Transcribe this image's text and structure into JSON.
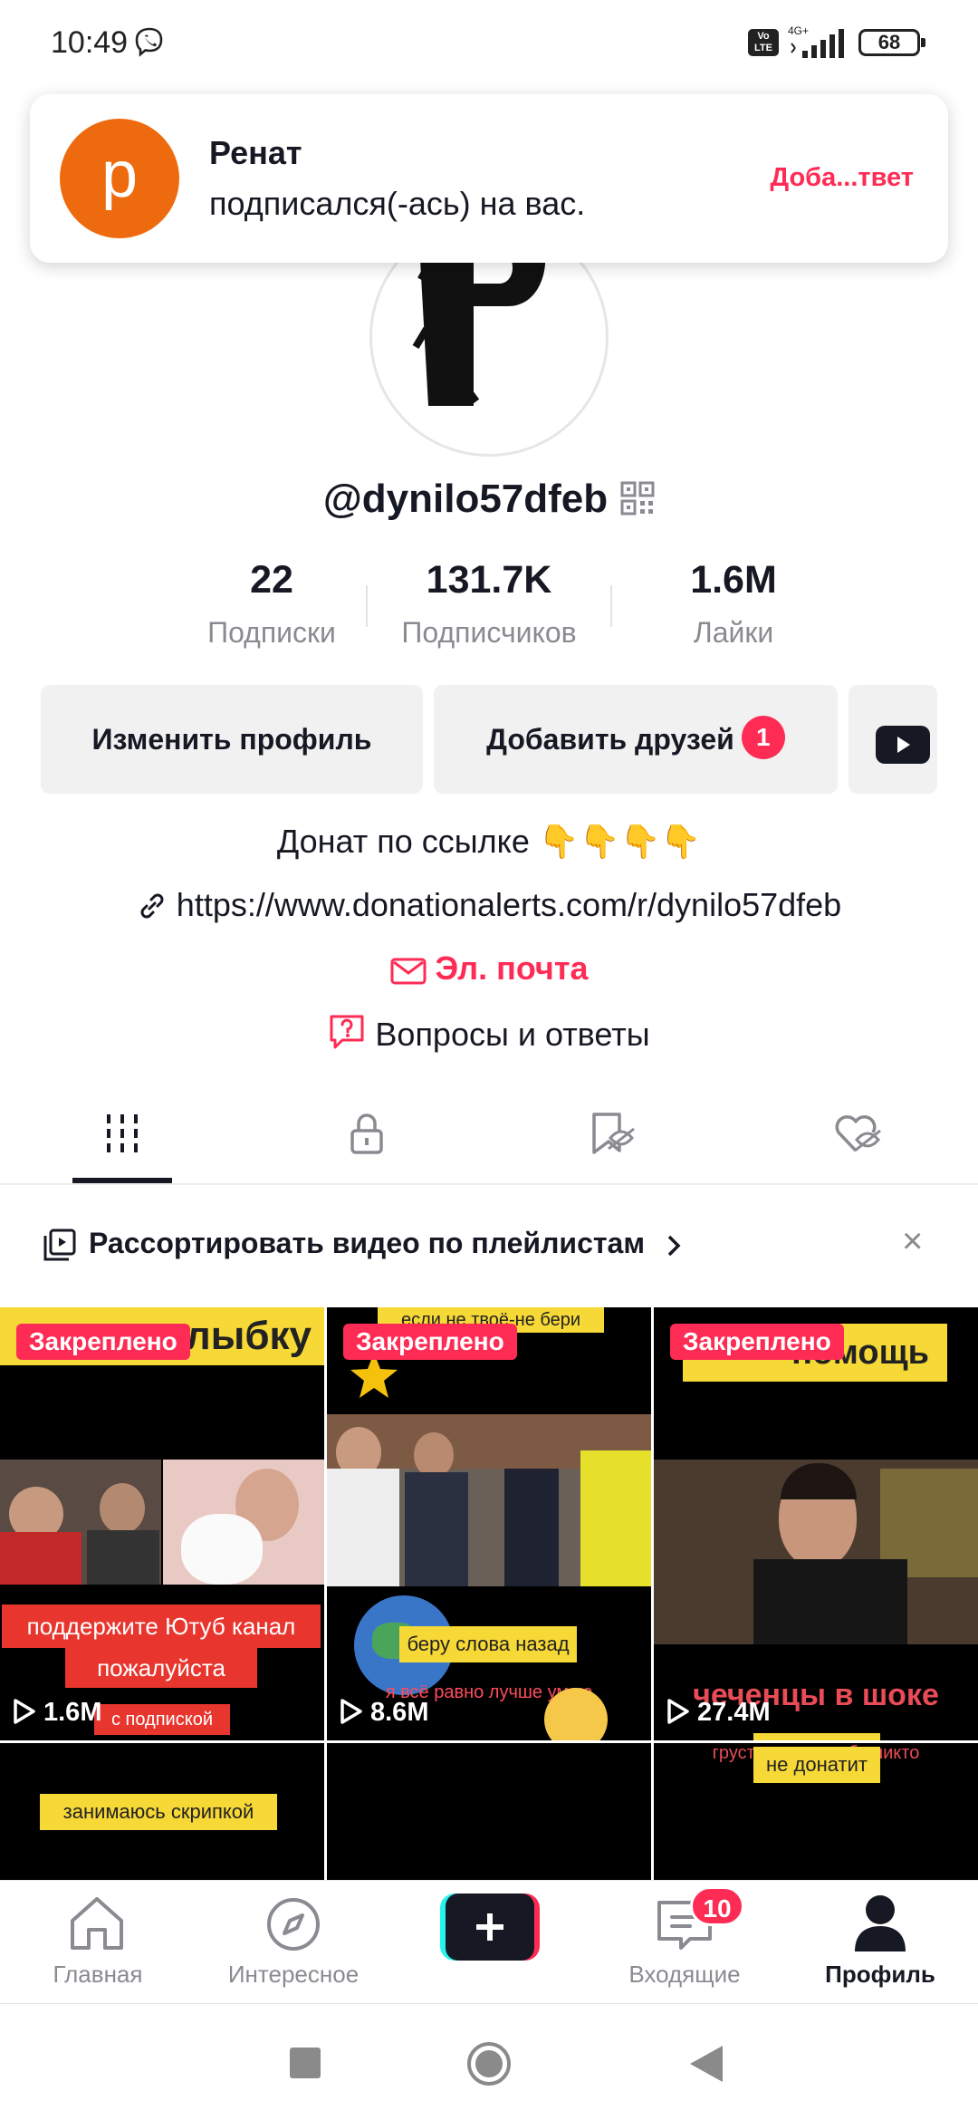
{
  "status_bar": {
    "time": "10:49",
    "volte": "Vo LTE",
    "network": "4G+",
    "battery": "68"
  },
  "notification": {
    "avatar_letter": "р",
    "name": "Ренат",
    "message": "подписался(-ась) на вас.",
    "action": "Доба...твет"
  },
  "profile": {
    "username": "@dynilo57dfeb",
    "stats": [
      {
        "value": "22",
        "label": "Подписки"
      },
      {
        "value": "131.7K",
        "label": "Подписчиков"
      },
      {
        "value": "1.6M",
        "label": "Лайки"
      }
    ],
    "edit_button": "Изменить профиль",
    "add_friends_button": "Добавить друзей",
    "add_friends_badge": "1",
    "bio": "Донат по ссылке 👇👇👇👇",
    "link": "https://www.donationalerts.com/r/dynilo57dfeb",
    "email": "Эл. почта",
    "qa": "Вопросы и ответы"
  },
  "tabs": [
    "videos",
    "private",
    "reposts",
    "liked"
  ],
  "playlist_bar": {
    "text": "Рассортировать видео по плейлистам"
  },
  "videos": [
    {
      "pinned": "Закреплено",
      "views": "1.6M",
      "top_caption": "улыбку",
      "caption1": "поддержите Ютуб канал",
      "caption2": "пожалуйста",
      "caption3": "с подпиской"
    },
    {
      "pinned": "Закреплено",
      "views": "8.6M",
      "top_caption": "если не твоё-не бери",
      "caption1": "беру слова назад",
      "caption2": "я всё равно лучше умею"
    },
    {
      "pinned": "Закреплено",
      "views": "27.4M",
      "top_caption": "помощь",
      "caption1": "чеченцы в шоке",
      "caption2": "грустно когда тебе никто",
      "caption3": "не донатит"
    },
    {
      "caption1": "занимаюсь скрипкой"
    },
    {},
    {}
  ],
  "nav": {
    "home": "Главная",
    "discover": "Интересное",
    "inbox": "Входящие",
    "inbox_badge": "10",
    "profile": "Профиль"
  },
  "colors": {
    "accent": "#fe2c55",
    "text": "#161823",
    "muted": "#8a8b91",
    "notif_avatar": "#ee6a0f"
  }
}
